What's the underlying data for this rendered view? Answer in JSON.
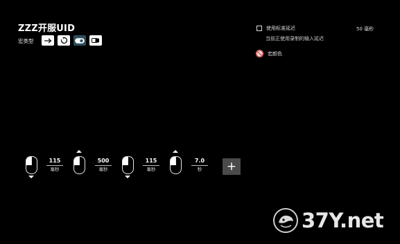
{
  "header": {
    "title": "ZZZ开服UID",
    "macro_type_label": "宏类型",
    "macro_types": [
      {
        "name": "once",
        "icon": "arrow-right-icon",
        "active": false
      },
      {
        "name": "repeat",
        "icon": "loop-icon",
        "active": false
      },
      {
        "name": "toggle",
        "icon": "toggle-icon",
        "active": true
      },
      {
        "name": "hold",
        "icon": "hold-icon",
        "active": false
      }
    ]
  },
  "settings": {
    "use_standard_delay_label": "使用标准延迟",
    "use_standard_delay_checked": false,
    "standard_delay_value": "50 毫秒",
    "recorded_delay_note": "当前正使用录制的输入延迟",
    "macro_color_label": "宏颜色"
  },
  "sequence": {
    "steps": [
      {
        "type": "mouse-left",
        "direction": "down"
      },
      {
        "type": "delay",
        "value": "115",
        "unit": "毫秒"
      },
      {
        "type": "mouse-left",
        "direction": "up"
      },
      {
        "type": "delay",
        "value": "500",
        "unit": "毫秒"
      },
      {
        "type": "mouse-left",
        "direction": "down"
      },
      {
        "type": "delay",
        "value": "115",
        "unit": "毫秒"
      },
      {
        "type": "mouse-left",
        "direction": "up"
      },
      {
        "type": "delay",
        "value": "7.0",
        "unit": "秒"
      }
    ],
    "add_label": "+"
  },
  "watermark": {
    "text": "37Y.net"
  }
}
